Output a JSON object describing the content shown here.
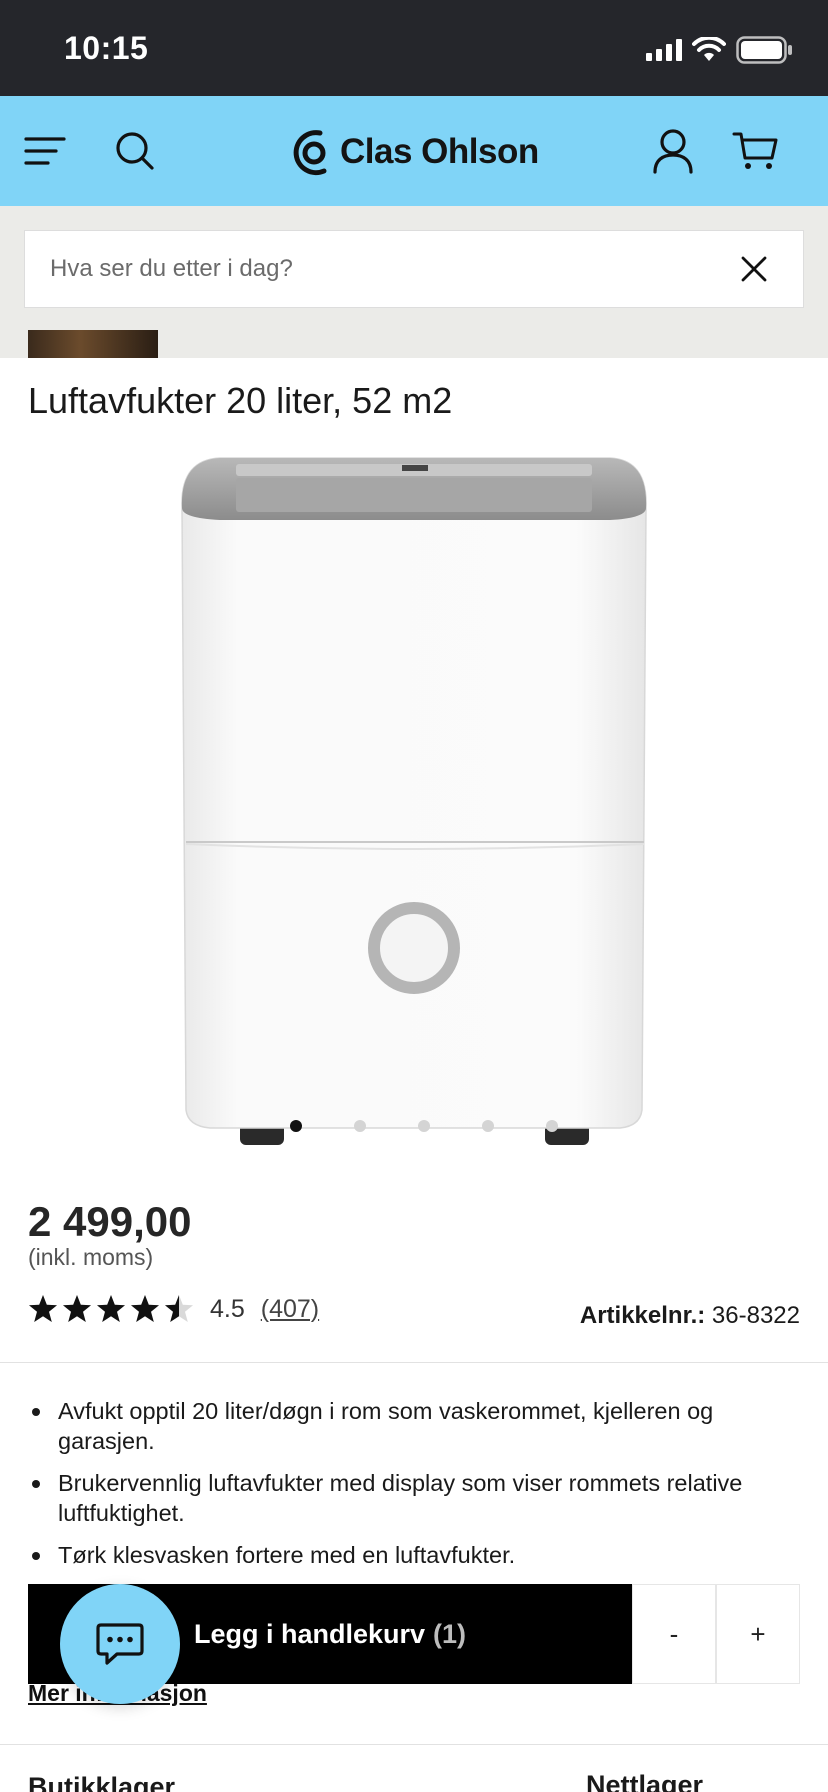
{
  "status_bar": {
    "time": "10:15"
  },
  "header": {
    "logo_text": "Clas Ohlson"
  },
  "search": {
    "placeholder": "Hva ser du etter i dag?"
  },
  "product": {
    "title": "Luftavfukter 20 liter, 52 m2",
    "image_count": 5,
    "active_image": 0,
    "price": "2 499,00",
    "vat_note": "(inkl. moms)",
    "rating_value": "4.5",
    "rating_count": "(407)",
    "rating_fraction": 0.9,
    "article_label": "Artikkelnr.:",
    "article_number": "36-8322",
    "bullets": [
      "Avfukt opptil 20 liter/døgn i rom som vaskerommet, kjelleren og garasjen.",
      "Brukervennlig luftavfukter med display som viser rommets relative luftfuktighet.",
      "Tørk klesvasken fortere med en luftavfukter."
    ]
  },
  "cart": {
    "add_label": "Legg i handlekurv",
    "quantity": "(1)",
    "minus": "-",
    "plus": "+"
  },
  "more_info": "Mer informasjon",
  "stock": {
    "store": "Butikklager",
    "online": "Nettlager"
  },
  "colors": {
    "header": "#80d4f7",
    "status_bar": "#25262b",
    "button": "#000000"
  }
}
